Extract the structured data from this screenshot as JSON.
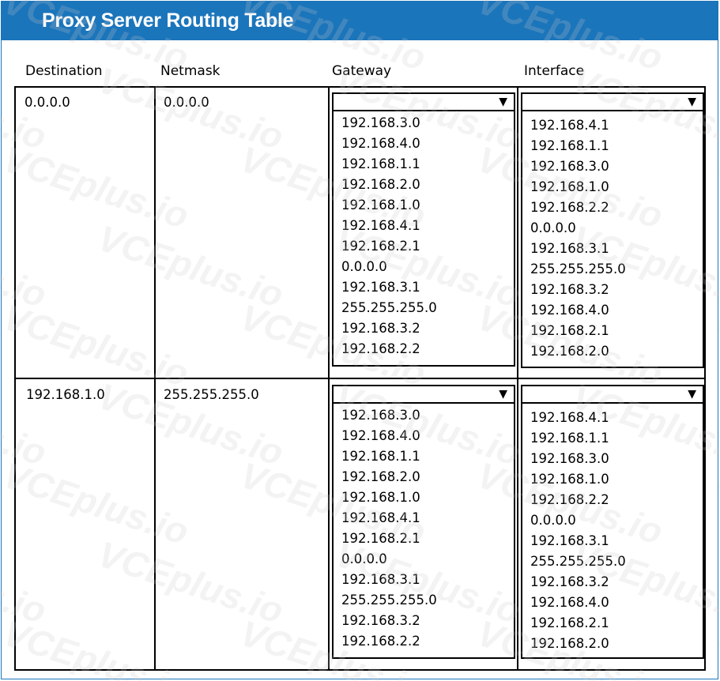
{
  "title": "Proxy Server Routing Table",
  "columns": [
    "Destination",
    "Netmask",
    "Gateway",
    "Interface"
  ],
  "rows": [
    {
      "destination": "0.0.0.0",
      "netmask": "0.0.0.0",
      "gateway_selected": "",
      "interface_selected": ""
    },
    {
      "destination": "192.168.1.0",
      "netmask": "255.255.255.0",
      "gateway_selected": "",
      "interface_selected": ""
    }
  ],
  "gateway_options": [
    "192.168.3.0",
    "192.168.4.0",
    "192.168.1.1",
    "192.168.2.0",
    "192.168.1.0",
    "192.168.4.1",
    "192.168.2.1",
    "0.0.0.0",
    "192.168.3.1",
    "255.255.255.0",
    "192.168.3.2",
    "192.168.2.2"
  ],
  "interface_options": [
    "192.168.4.1",
    "192.168.1.1",
    "192.168.3.0",
    "192.168.1.0",
    "192.168.2.2",
    "0.0.0.0",
    "192.168.3.1",
    "255.255.255.0",
    "192.168.3.2",
    "192.168.4.0",
    "192.168.2.1",
    "192.168.2.0"
  ],
  "dropdown_arrow": "▼",
  "watermark": "VCEplus.io",
  "colors": {
    "title_bar": "#1b75bb",
    "title_text": "#ffffff",
    "border": "#000000"
  }
}
